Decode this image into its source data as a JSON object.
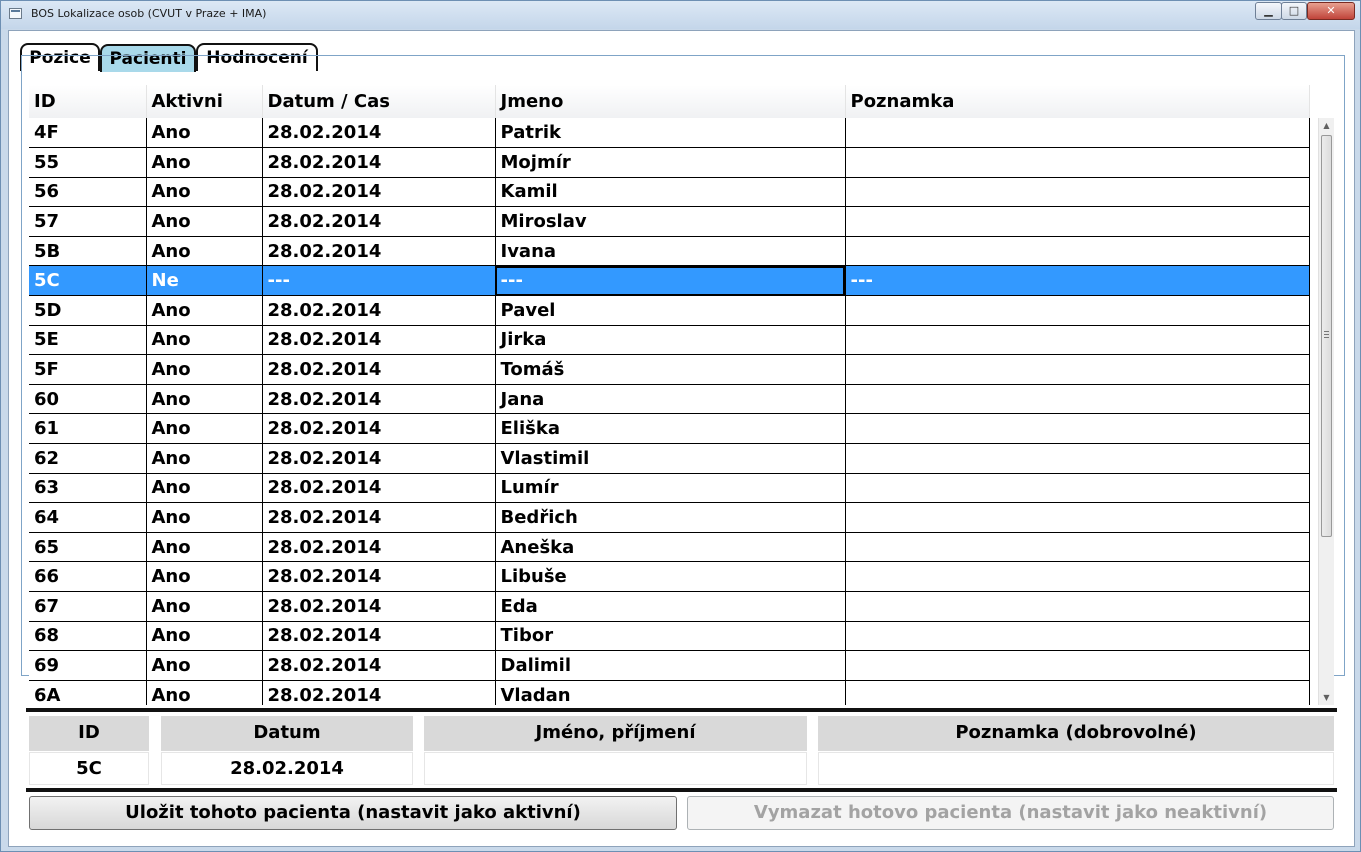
{
  "window": {
    "title": "BOS Lokalizace osob (CVUT v Praze + IMA)",
    "min_glyph": "▁",
    "max_glyph": "□",
    "close_glyph": "✕"
  },
  "tabs": [
    {
      "label": "Pozice"
    },
    {
      "label": "Pacienti",
      "active": true
    },
    {
      "label": "Hodnocení"
    }
  ],
  "grid": {
    "columns": [
      "ID",
      "Aktivni",
      "Datum / Cas",
      "Jmeno",
      "Poznamka"
    ],
    "rows": [
      [
        "4F",
        "Ano",
        "28.02.2014",
        "Patrik",
        ""
      ],
      [
        "55",
        "Ano",
        "28.02.2014",
        "Mojmír",
        ""
      ],
      [
        "56",
        "Ano",
        "28.02.2014",
        "Kamil",
        ""
      ],
      [
        "57",
        "Ano",
        "28.02.2014",
        "Miroslav",
        ""
      ],
      [
        "5B",
        "Ano",
        "28.02.2014",
        "Ivana",
        ""
      ],
      [
        "5C",
        "Ne",
        "---",
        "---",
        "---"
      ],
      [
        "5D",
        "Ano",
        "28.02.2014",
        "Pavel",
        ""
      ],
      [
        "5E",
        "Ano",
        "28.02.2014",
        "Jirka",
        ""
      ],
      [
        "5F",
        "Ano",
        "28.02.2014",
        "Tomáš",
        ""
      ],
      [
        "60",
        "Ano",
        "28.02.2014",
        "Jana",
        ""
      ],
      [
        "61",
        "Ano",
        "28.02.2014",
        "Eliška",
        ""
      ],
      [
        "62",
        "Ano",
        "28.02.2014",
        "Vlastimil",
        ""
      ],
      [
        "63",
        "Ano",
        "28.02.2014",
        "Lumír",
        ""
      ],
      [
        "64",
        "Ano",
        "28.02.2014",
        "Bedřich",
        ""
      ],
      [
        "65",
        "Ano",
        "28.02.2014",
        "Aneška",
        ""
      ],
      [
        "66",
        "Ano",
        "28.02.2014",
        "Libuše",
        ""
      ],
      [
        "67",
        "Ano",
        "28.02.2014",
        "Eda",
        ""
      ],
      [
        "68",
        "Ano",
        "28.02.2014",
        "Tibor",
        ""
      ],
      [
        "69",
        "Ano",
        "28.02.2014",
        "Dalimil",
        ""
      ],
      [
        "6A",
        "Ano",
        "28.02.2014",
        "Vladan",
        ""
      ]
    ],
    "selected_row": 5,
    "scroll_up_glyph": "▲",
    "scroll_down_glyph": "▼"
  },
  "form": {
    "headers": {
      "id": "ID",
      "datum": "Datum",
      "jmeno": "Jméno, příjmení",
      "poznamka": "Poznamka (dobrovolné)"
    },
    "values": {
      "id": "5C",
      "datum": "28.02.2014",
      "jmeno": "",
      "poznamka": ""
    }
  },
  "buttons": {
    "save": "Uložit tohoto pacienta (nastavit jako aktivní)",
    "clear": "Vymazat hotovo pacienta (nastavit jako neaktivní)"
  },
  "colors": {
    "selection": "#3399ff",
    "active_tab": "#a9d9ea",
    "form_header": "#d9d9d9"
  }
}
